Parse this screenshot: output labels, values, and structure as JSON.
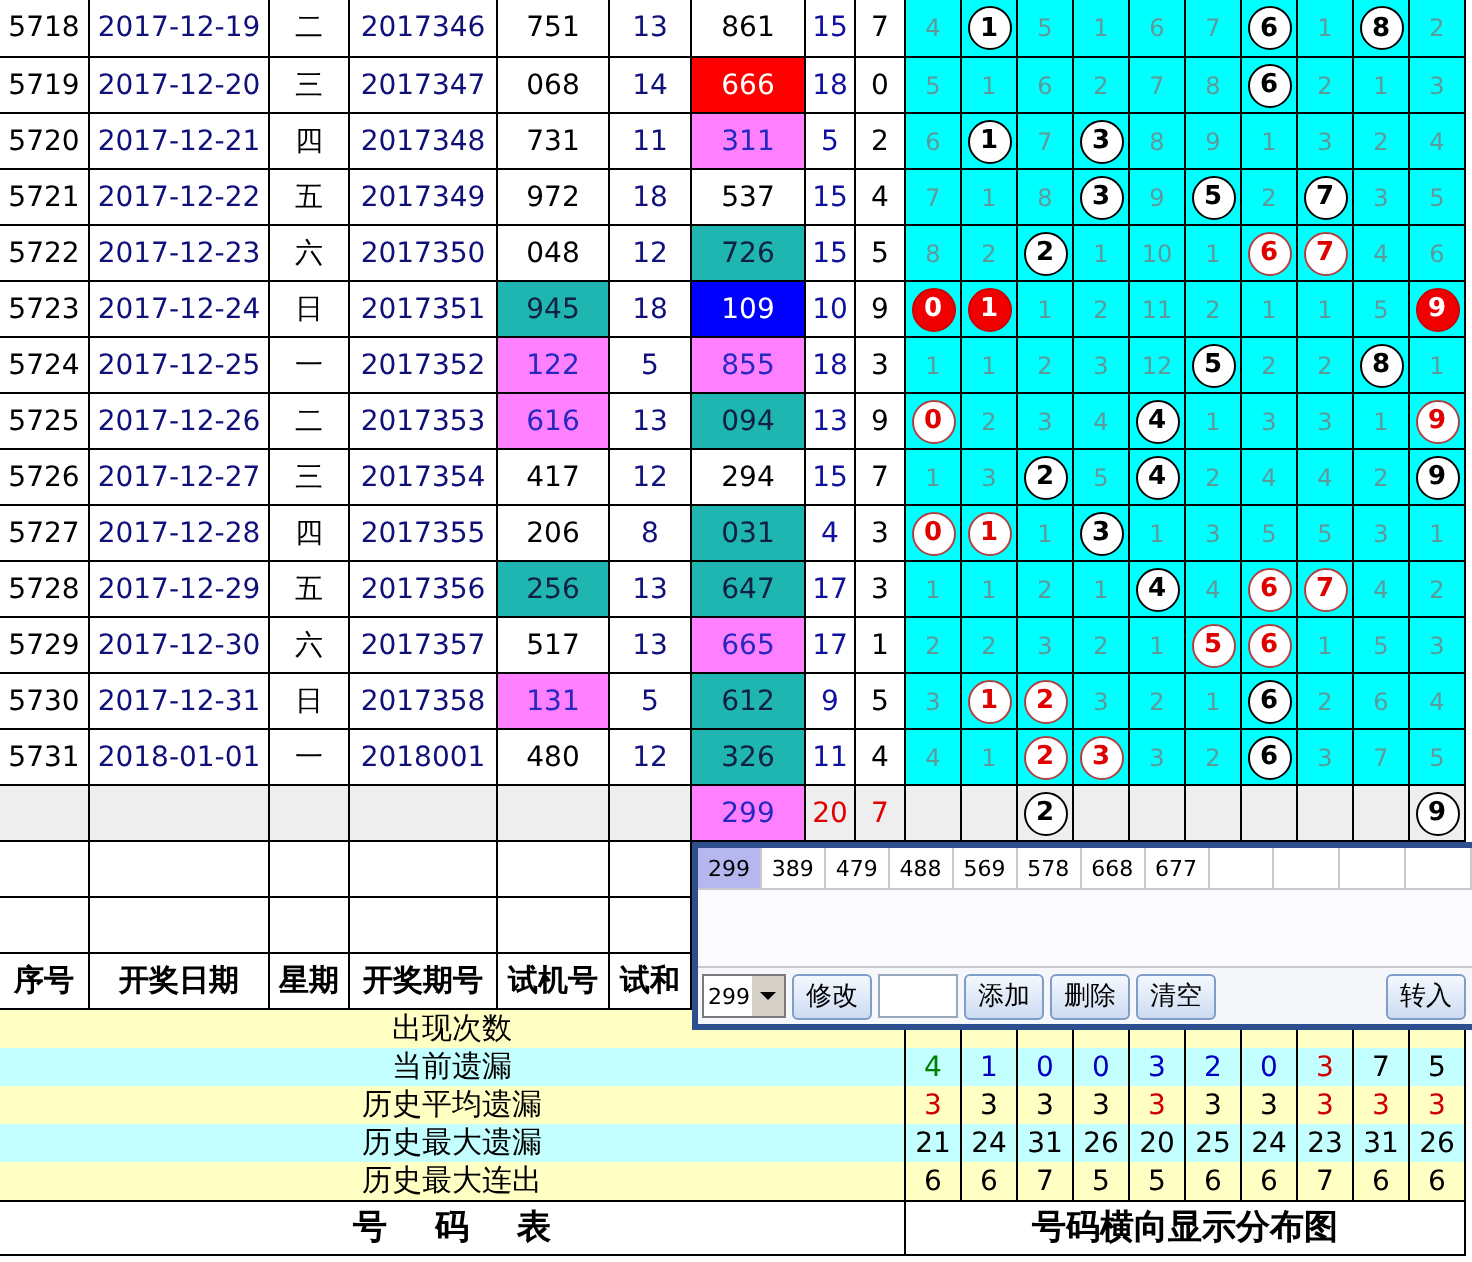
{
  "rows": [
    {
      "pending": false,
      "no": "5718",
      "date": "2017-12-19",
      "weekday": "二",
      "period": "2017346",
      "test": {
        "text": "751"
      },
      "test_sum": "13",
      "draw": {
        "text": "861"
      },
      "column_8": "15",
      "column_9": "7",
      "cells": [
        {
          "kind": "miss",
          "text": "4"
        },
        {
          "kind": "ball",
          "text": "1"
        },
        {
          "kind": "miss",
          "text": "5"
        },
        {
          "kind": "miss",
          "text": "1"
        },
        {
          "kind": "miss",
          "text": "6"
        },
        {
          "kind": "miss",
          "text": "7"
        },
        {
          "kind": "ball",
          "text": "6"
        },
        {
          "kind": "miss",
          "text": "1"
        },
        {
          "kind": "ball",
          "text": "8"
        },
        {
          "kind": "miss",
          "text": "2"
        }
      ]
    },
    {
      "pending": false,
      "no": "5719",
      "date": "2017-12-20",
      "weekday": "三",
      "period": "2017347",
      "test": {
        "text": "068"
      },
      "test_sum": "14",
      "draw": {
        "text": "666",
        "color": "#ff0000"
      },
      "column_8": "18",
      "column_9": "0",
      "cells": [
        {
          "kind": "miss",
          "text": "5"
        },
        {
          "kind": "miss",
          "text": "1"
        },
        {
          "kind": "miss",
          "text": "6"
        },
        {
          "kind": "miss",
          "text": "2"
        },
        {
          "kind": "miss",
          "text": "7"
        },
        {
          "kind": "miss",
          "text": "8"
        },
        {
          "kind": "ball",
          "text": "6"
        },
        {
          "kind": "miss",
          "text": "2"
        },
        {
          "kind": "miss",
          "text": "1"
        },
        {
          "kind": "miss",
          "text": "3"
        }
      ]
    },
    {
      "pending": false,
      "no": "5720",
      "date": "2017-12-21",
      "weekday": "四",
      "period": "2017348",
      "test": {
        "text": "731"
      },
      "test_sum": "11",
      "draw": {
        "text": "311",
        "color": "#ff80ff"
      },
      "column_8": "5",
      "column_9": "2",
      "cells": [
        {
          "kind": "miss",
          "text": "6"
        },
        {
          "kind": "ball",
          "text": "1"
        },
        {
          "kind": "miss",
          "text": "7"
        },
        {
          "kind": "ball",
          "text": "3"
        },
        {
          "kind": "miss",
          "text": "8"
        },
        {
          "kind": "miss",
          "text": "9"
        },
        {
          "kind": "miss",
          "text": "1"
        },
        {
          "kind": "miss",
          "text": "3"
        },
        {
          "kind": "miss",
          "text": "2"
        },
        {
          "kind": "miss",
          "text": "4"
        }
      ]
    },
    {
      "pending": false,
      "no": "5721",
      "date": "2017-12-22",
      "weekday": "五",
      "period": "2017349",
      "test": {
        "text": "972"
      },
      "test_sum": "18",
      "draw": {
        "text": "537"
      },
      "column_8": "15",
      "column_9": "4",
      "cells": [
        {
          "kind": "miss",
          "text": "7"
        },
        {
          "kind": "miss",
          "text": "1"
        },
        {
          "kind": "miss",
          "text": "8"
        },
        {
          "kind": "ball",
          "text": "3"
        },
        {
          "kind": "miss",
          "text": "9"
        },
        {
          "kind": "ball",
          "text": "5"
        },
        {
          "kind": "miss",
          "text": "2"
        },
        {
          "kind": "ball",
          "text": "7"
        },
        {
          "kind": "miss",
          "text": "3"
        },
        {
          "kind": "miss",
          "text": "5"
        }
      ]
    },
    {
      "pending": false,
      "no": "5722",
      "date": "2017-12-23",
      "weekday": "六",
      "period": "2017350",
      "test": {
        "text": "048"
      },
      "test_sum": "12",
      "draw": {
        "text": "726",
        "color": "#1fb5b0"
      },
      "column_8": "15",
      "column_9": "5",
      "cells": [
        {
          "kind": "miss",
          "text": "8"
        },
        {
          "kind": "miss",
          "text": "2"
        },
        {
          "kind": "ball",
          "text": "2"
        },
        {
          "kind": "miss",
          "text": "1"
        },
        {
          "kind": "miss",
          "text": "10"
        },
        {
          "kind": "miss",
          "text": "1"
        },
        {
          "kind": "redring",
          "text": "6"
        },
        {
          "kind": "redring",
          "text": "7"
        },
        {
          "kind": "miss",
          "text": "4"
        },
        {
          "kind": "miss",
          "text": "6"
        }
      ]
    },
    {
      "pending": false,
      "no": "5723",
      "date": "2017-12-24",
      "weekday": "日",
      "period": "2017351",
      "test": {
        "text": "945",
        "color": "#1fb5b0"
      },
      "test_sum": "18",
      "draw": {
        "text": "109",
        "color": "#0000ff"
      },
      "column_8": "10",
      "column_9": "9",
      "cells": [
        {
          "kind": "redball",
          "text": "0"
        },
        {
          "kind": "redball",
          "text": "1"
        },
        {
          "kind": "miss",
          "text": "1"
        },
        {
          "kind": "miss",
          "text": "2"
        },
        {
          "kind": "miss",
          "text": "11"
        },
        {
          "kind": "miss",
          "text": "2"
        },
        {
          "kind": "miss",
          "text": "1"
        },
        {
          "kind": "miss",
          "text": "1"
        },
        {
          "kind": "miss",
          "text": "5"
        },
        {
          "kind": "redball",
          "text": "9"
        }
      ]
    },
    {
      "pending": false,
      "no": "5724",
      "date": "2017-12-25",
      "weekday": "一",
      "period": "2017352",
      "test": {
        "text": "122",
        "color": "#ff80ff"
      },
      "test_sum": "5",
      "draw": {
        "text": "855",
        "color": "#ff80ff"
      },
      "column_8": "18",
      "column_9": "3",
      "cells": [
        {
          "kind": "miss",
          "text": "1"
        },
        {
          "kind": "miss",
          "text": "1"
        },
        {
          "kind": "miss",
          "text": "2"
        },
        {
          "kind": "miss",
          "text": "3"
        },
        {
          "kind": "miss",
          "text": "12"
        },
        {
          "kind": "ball",
          "text": "5"
        },
        {
          "kind": "miss",
          "text": "2"
        },
        {
          "kind": "miss",
          "text": "2"
        },
        {
          "kind": "ball",
          "text": "8"
        },
        {
          "kind": "miss",
          "text": "1"
        }
      ]
    },
    {
      "pending": false,
      "no": "5725",
      "date": "2017-12-26",
      "weekday": "二",
      "period": "2017353",
      "test": {
        "text": "616",
        "color": "#ff80ff"
      },
      "test_sum": "13",
      "draw": {
        "text": "094",
        "color": "#1fb5b0"
      },
      "column_8": "13",
      "column_9": "9",
      "cells": [
        {
          "kind": "redring",
          "text": "0"
        },
        {
          "kind": "miss",
          "text": "2"
        },
        {
          "kind": "miss",
          "text": "3"
        },
        {
          "kind": "miss",
          "text": "4"
        },
        {
          "kind": "ball",
          "text": "4"
        },
        {
          "kind": "miss",
          "text": "1"
        },
        {
          "kind": "miss",
          "text": "3"
        },
        {
          "kind": "miss",
          "text": "3"
        },
        {
          "kind": "miss",
          "text": "1"
        },
        {
          "kind": "redring",
          "text": "9"
        }
      ]
    },
    {
      "pending": false,
      "no": "5726",
      "date": "2017-12-27",
      "weekday": "三",
      "period": "2017354",
      "test": {
        "text": "417"
      },
      "test_sum": "12",
      "draw": {
        "text": "294"
      },
      "column_8": "15",
      "column_9": "7",
      "cells": [
        {
          "kind": "miss",
          "text": "1"
        },
        {
          "kind": "miss",
          "text": "3"
        },
        {
          "kind": "ball",
          "text": "2"
        },
        {
          "kind": "miss",
          "text": "5"
        },
        {
          "kind": "ball",
          "text": "4"
        },
        {
          "kind": "miss",
          "text": "2"
        },
        {
          "kind": "miss",
          "text": "4"
        },
        {
          "kind": "miss",
          "text": "4"
        },
        {
          "kind": "miss",
          "text": "2"
        },
        {
          "kind": "ball",
          "text": "9"
        }
      ]
    },
    {
      "pending": false,
      "no": "5727",
      "date": "2017-12-28",
      "weekday": "四",
      "period": "2017355",
      "test": {
        "text": "206"
      },
      "test_sum": "8",
      "draw": {
        "text": "031",
        "color": "#1fb5b0"
      },
      "column_8": "4",
      "column_9": "3",
      "cells": [
        {
          "kind": "redring",
          "text": "0"
        },
        {
          "kind": "redring",
          "text": "1"
        },
        {
          "kind": "miss",
          "text": "1"
        },
        {
          "kind": "ball",
          "text": "3"
        },
        {
          "kind": "miss",
          "text": "1"
        },
        {
          "kind": "miss",
          "text": "3"
        },
        {
          "kind": "miss",
          "text": "5"
        },
        {
          "kind": "miss",
          "text": "5"
        },
        {
          "kind": "miss",
          "text": "3"
        },
        {
          "kind": "miss",
          "text": "1"
        }
      ]
    },
    {
      "pending": false,
      "no": "5728",
      "date": "2017-12-29",
      "weekday": "五",
      "period": "2017356",
      "test": {
        "text": "256",
        "color": "#1fb5b0"
      },
      "test_sum": "13",
      "draw": {
        "text": "647",
        "color": "#1fb5b0"
      },
      "column_8": "17",
      "column_9": "3",
      "cells": [
        {
          "kind": "miss",
          "text": "1"
        },
        {
          "kind": "miss",
          "text": "1"
        },
        {
          "kind": "miss",
          "text": "2"
        },
        {
          "kind": "miss",
          "text": "1"
        },
        {
          "kind": "ball",
          "text": "4"
        },
        {
          "kind": "miss",
          "text": "4"
        },
        {
          "kind": "redring",
          "text": "6"
        },
        {
          "kind": "redring",
          "text": "7"
        },
        {
          "kind": "miss",
          "text": "4"
        },
        {
          "kind": "miss",
          "text": "2"
        }
      ]
    },
    {
      "pending": false,
      "no": "5729",
      "date": "2017-12-30",
      "weekday": "六",
      "period": "2017357",
      "test": {
        "text": "517"
      },
      "test_sum": "13",
      "draw": {
        "text": "665",
        "color": "#ff80ff"
      },
      "column_8": "17",
      "column_9": "1",
      "cells": [
        {
          "kind": "miss",
          "text": "2"
        },
        {
          "kind": "miss",
          "text": "2"
        },
        {
          "kind": "miss",
          "text": "3"
        },
        {
          "kind": "miss",
          "text": "2"
        },
        {
          "kind": "miss",
          "text": "1"
        },
        {
          "kind": "redring",
          "text": "5"
        },
        {
          "kind": "redring",
          "text": "6"
        },
        {
          "kind": "miss",
          "text": "1"
        },
        {
          "kind": "miss",
          "text": "5"
        },
        {
          "kind": "miss",
          "text": "3"
        }
      ]
    },
    {
      "pending": false,
      "no": "5730",
      "date": "2017-12-31",
      "weekday": "日",
      "period": "2017358",
      "test": {
        "text": "131",
        "color": "#ff80ff"
      },
      "test_sum": "5",
      "draw": {
        "text": "612",
        "color": "#1fb5b0"
      },
      "column_8": "9",
      "column_9": "5",
      "cells": [
        {
          "kind": "miss",
          "text": "3"
        },
        {
          "kind": "redring",
          "text": "1"
        },
        {
          "kind": "redring",
          "text": "2"
        },
        {
          "kind": "miss",
          "text": "3"
        },
        {
          "kind": "miss",
          "text": "2"
        },
        {
          "kind": "miss",
          "text": "1"
        },
        {
          "kind": "ball",
          "text": "6"
        },
        {
          "kind": "miss",
          "text": "2"
        },
        {
          "kind": "miss",
          "text": "6"
        },
        {
          "kind": "miss",
          "text": "4"
        }
      ]
    },
    {
      "pending": false,
      "no": "5731",
      "date": "2018-01-01",
      "weekday": "一",
      "period": "2018001",
      "test": {
        "text": "480"
      },
      "test_sum": "12",
      "draw": {
        "text": "326",
        "color": "#1fb5b0"
      },
      "column_8": "11",
      "column_9": "4",
      "cells": [
        {
          "kind": "miss",
          "text": "4"
        },
        {
          "kind": "miss",
          "text": "1"
        },
        {
          "kind": "redring",
          "text": "2"
        },
        {
          "kind": "redring",
          "text": "3"
        },
        {
          "kind": "miss",
          "text": "3"
        },
        {
          "kind": "miss",
          "text": "2"
        },
        {
          "kind": "ball",
          "text": "6"
        },
        {
          "kind": "miss",
          "text": "3"
        },
        {
          "kind": "miss",
          "text": "7"
        },
        {
          "kind": "miss",
          "text": "5"
        }
      ]
    },
    {
      "pending": true,
      "draw": {
        "text": "299",
        "color": "#ff80ff"
      },
      "column_8": "20",
      "column_9": "7",
      "cells": [
        {
          "kind": "blank"
        },
        {
          "kind": "blank"
        },
        {
          "kind": "ball",
          "text": "2"
        },
        {
          "kind": "blank"
        },
        {
          "kind": "blank"
        },
        {
          "kind": "blank"
        },
        {
          "kind": "blank"
        },
        {
          "kind": "blank"
        },
        {
          "kind": "blank"
        },
        {
          "kind": "ball",
          "text": "9"
        }
      ]
    }
  ],
  "header": [
    "序号",
    "开奖日期",
    "星期",
    "开奖期号",
    "试机号",
    "试和"
  ],
  "stats": [
    {
      "label": "出现次数"
    },
    {
      "label": "当前遗漏",
      "values": [
        {
          "text": "4",
          "color": "#008000"
        },
        {
          "text": "1",
          "color": "#0000c0"
        },
        {
          "text": "0",
          "color": "#0000c0"
        },
        {
          "text": "0",
          "color": "#0000c0"
        },
        {
          "text": "3",
          "color": "#0000c0"
        },
        {
          "text": "2",
          "color": "#0000c0"
        },
        {
          "text": "0",
          "color": "#0000c0"
        },
        {
          "text": "3",
          "color": "#d00000"
        },
        {
          "text": "7",
          "color": "#000000"
        },
        {
          "text": "5",
          "color": "#000000"
        }
      ]
    },
    {
      "label": "历史平均遗漏",
      "values": [
        {
          "text": "3",
          "color": "#d00000"
        },
        {
          "text": "3",
          "color": "#000000"
        },
        {
          "text": "3",
          "color": "#000000"
        },
        {
          "text": "3",
          "color": "#000000"
        },
        {
          "text": "3",
          "color": "#d00000"
        },
        {
          "text": "3",
          "color": "#000000"
        },
        {
          "text": "3",
          "color": "#000000"
        },
        {
          "text": "3",
          "color": "#d00000"
        },
        {
          "text": "3",
          "color": "#d00000"
        },
        {
          "text": "3",
          "color": "#d00000"
        }
      ]
    },
    {
      "label": "历史最大遗漏",
      "values": [
        {
          "text": "21",
          "color": "#000000"
        },
        {
          "text": "24",
          "color": "#000000"
        },
        {
          "text": "31",
          "color": "#000000"
        },
        {
          "text": "26",
          "color": "#000000"
        },
        {
          "text": "20",
          "color": "#000000"
        },
        {
          "text": "25",
          "color": "#000000"
        },
        {
          "text": "24",
          "color": "#000000"
        },
        {
          "text": "23",
          "color": "#000000"
        },
        {
          "text": "31",
          "color": "#000000"
        },
        {
          "text": "26",
          "color": "#000000"
        }
      ]
    },
    {
      "label": "历史最大连出",
      "values": [
        {
          "text": "6",
          "color": "#000000"
        },
        {
          "text": "6",
          "color": "#000000"
        },
        {
          "text": "7",
          "color": "#000000"
        },
        {
          "text": "5",
          "color": "#000000"
        },
        {
          "text": "5",
          "color": "#000000"
        },
        {
          "text": "6",
          "color": "#000000"
        },
        {
          "text": "6",
          "color": "#000000"
        },
        {
          "text": "7",
          "color": "#000000"
        },
        {
          "text": "6",
          "color": "#000000"
        },
        {
          "text": "6",
          "color": "#000000"
        }
      ]
    }
  ],
  "footer": {
    "left": "号 码 表",
    "right": "号码横向显示分布图"
  },
  "dialog": {
    "candidates": [
      {
        "text": "299",
        "selected": true
      },
      {
        "text": "389",
        "selected": false
      },
      {
        "text": "479",
        "selected": false
      },
      {
        "text": "488",
        "selected": false
      },
      {
        "text": "569",
        "selected": false
      },
      {
        "text": "578",
        "selected": false
      },
      {
        "text": "668",
        "selected": false
      },
      {
        "text": "677",
        "selected": false
      }
    ],
    "toolbar": [
      {
        "kind": "combo",
        "text": "299"
      },
      {
        "kind": "button",
        "text": "修改"
      },
      {
        "kind": "input"
      },
      {
        "kind": "button",
        "text": "添加"
      },
      {
        "kind": "button",
        "text": "删除"
      },
      {
        "kind": "button",
        "text": "清空"
      }
    ],
    "side_button": "转入"
  }
}
